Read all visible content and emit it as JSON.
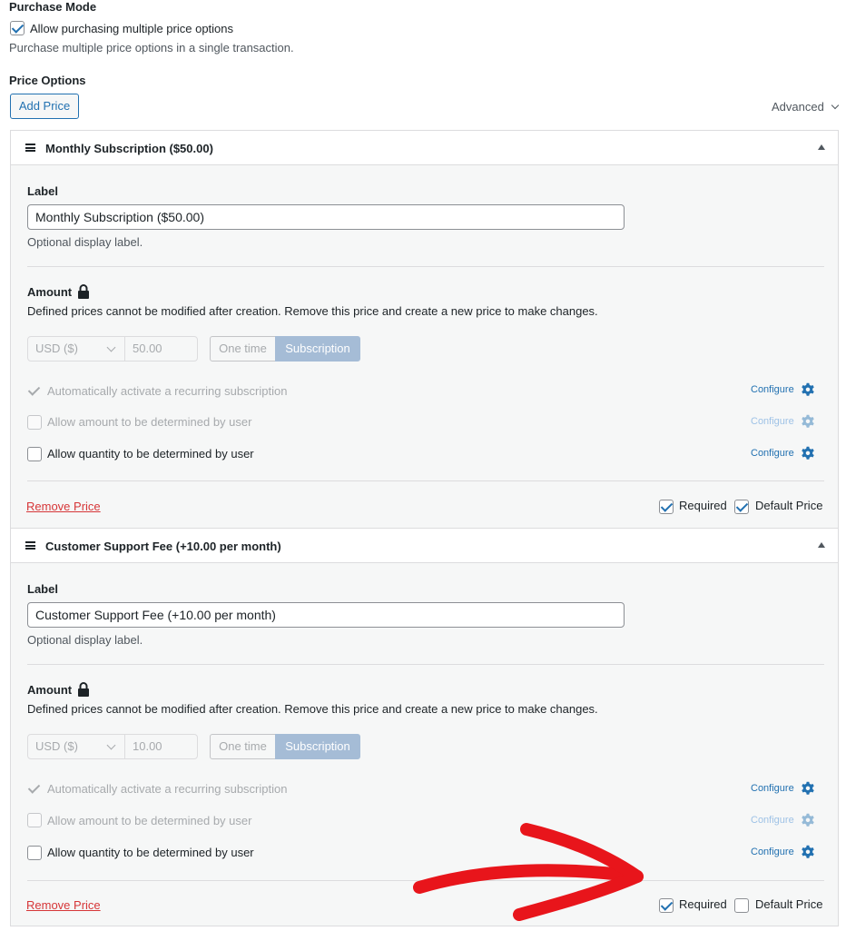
{
  "purchase_mode": {
    "heading": "Purchase Mode",
    "checkbox_label": "Allow purchasing multiple price options",
    "checked": true,
    "help": "Purchase multiple price options in a single transaction."
  },
  "price_options": {
    "heading": "Price Options",
    "add_button": "Add Price",
    "advanced_label": "Advanced"
  },
  "prices": [
    {
      "title": "Monthly Subscription ($50.00)",
      "label_heading": "Label",
      "label_value": "Monthly Subscription ($50.00)",
      "label_help": "Optional display label.",
      "amount_heading": "Amount",
      "amount_help": "Defined prices cannot be modified after creation. Remove this price and create a new price to make changes.",
      "currency": "USD ($)",
      "amount": "50.00",
      "type_one_time": "One time",
      "type_subscription": "Subscription",
      "options": [
        {
          "label": "Automatically activate a recurring subscription",
          "configure": "Configure"
        },
        {
          "label": "Allow amount to be determined by user",
          "configure": "Configure"
        },
        {
          "label": "Allow quantity to be determined by user",
          "configure": "Configure"
        }
      ],
      "remove_label": "Remove Price",
      "required_label": "Required",
      "required_checked": true,
      "default_label": "Default Price",
      "default_checked": true
    },
    {
      "title": "Customer Support Fee (+10.00 per month)",
      "label_heading": "Label",
      "label_value": "Customer Support Fee (+10.00 per month)",
      "label_help": "Optional display label.",
      "amount_heading": "Amount",
      "amount_help": "Defined prices cannot be modified after creation. Remove this price and create a new price to make changes.",
      "currency": "USD ($)",
      "amount": "10.00",
      "type_one_time": "One time",
      "type_subscription": "Subscription",
      "options": [
        {
          "label": "Automatically activate a recurring subscription",
          "configure": "Configure"
        },
        {
          "label": "Allow amount to be determined by user",
          "configure": "Configure"
        },
        {
          "label": "Allow quantity to be determined by user",
          "configure": "Configure"
        }
      ],
      "remove_label": "Remove Price",
      "required_label": "Required",
      "required_checked": true,
      "default_label": "Default Price",
      "default_checked": false
    }
  ],
  "colors": {
    "accent": "#2271b1",
    "danger": "#d63638",
    "annotation_arrow": "#e8151b"
  }
}
